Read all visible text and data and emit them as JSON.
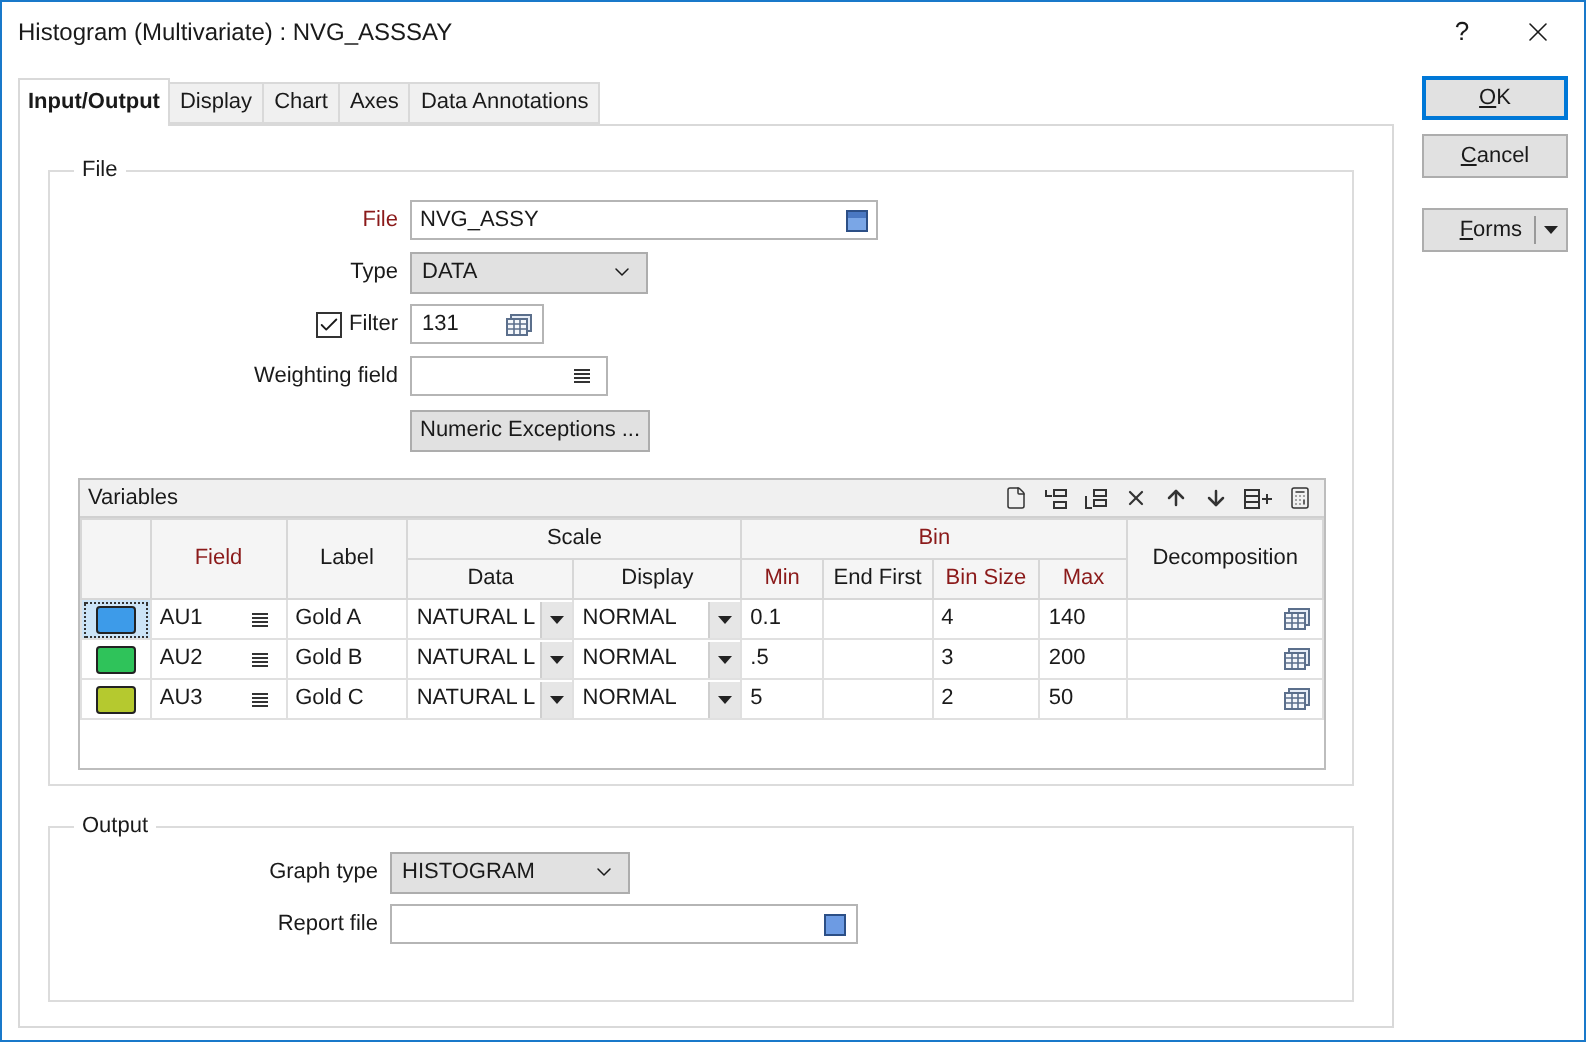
{
  "window": {
    "title": "Histogram (Multivariate) : NVG_ASSSAY",
    "help": "?"
  },
  "tabs": [
    {
      "label": "Input/Output",
      "selected": true
    },
    {
      "label": "Display",
      "selected": false
    },
    {
      "label": "Chart",
      "selected": false
    },
    {
      "label": "Axes",
      "selected": false
    },
    {
      "label": "Data Annotations",
      "selected": false
    }
  ],
  "file_group": {
    "title": "File",
    "file": {
      "label": "File",
      "value": "NVG_ASSY",
      "required": true
    },
    "type": {
      "label": "Type",
      "value": "DATA",
      "required": false
    },
    "filter": {
      "label": "Filter",
      "checked": true,
      "value": "131"
    },
    "weighting_field": {
      "label": "Weighting field"
    },
    "numeric_exceptions_button": "Numeric Exceptions ...",
    "variables": {
      "title": "Variables",
      "columns": [
        {
          "label": "Field",
          "required": true
        },
        {
          "label": "Label",
          "required": false
        }
      ],
      "scale": {
        "label": "Scale",
        "columns": [
          {
            "label": "Data",
            "required": false
          },
          {
            "label": "Display",
            "required": false
          }
        ]
      },
      "bin": {
        "label": "Bin",
        "required": true,
        "columns": [
          {
            "label": "Min",
            "required": true
          },
          {
            "label": "End First",
            "required": false
          },
          {
            "label": "Bin Size",
            "required": true
          },
          {
            "label": "Max",
            "required": true
          }
        ]
      },
      "decomposition": {
        "label": "Decomposition"
      },
      "rows": [
        {
          "color": "#3d9be9",
          "selected": true,
          "field": "AU1",
          "label": "Gold A",
          "data": "NATURAL L",
          "display": "NORMAL",
          "min": "0.1",
          "bin_size": "4",
          "max": "140"
        },
        {
          "color": "#2fc35a",
          "selected": false,
          "field": "AU2",
          "label": "Gold B",
          "data": "NATURAL L",
          "display": "NORMAL",
          "min": ".5",
          "bin_size": "3",
          "max": "200"
        },
        {
          "color": "#b5c92f",
          "selected": false,
          "field": "AU3",
          "label": "Gold C",
          "data": "NATURAL L",
          "display": "NORMAL",
          "min": "5",
          "bin_size": "2",
          "max": "50"
        }
      ]
    }
  },
  "output_group": {
    "title": "Output",
    "graph_type": {
      "label": "Graph type",
      "value": "HISTOGRAM"
    },
    "report_file": {
      "label": "Report file"
    }
  },
  "buttons": [
    {
      "access_key": "O",
      "label_rest": "K",
      "default": true
    },
    {
      "access_key": "C",
      "label_rest": "ancel",
      "default": false
    }
  ],
  "forms_button": {
    "access_key": "F",
    "label_rest": "orms"
  }
}
